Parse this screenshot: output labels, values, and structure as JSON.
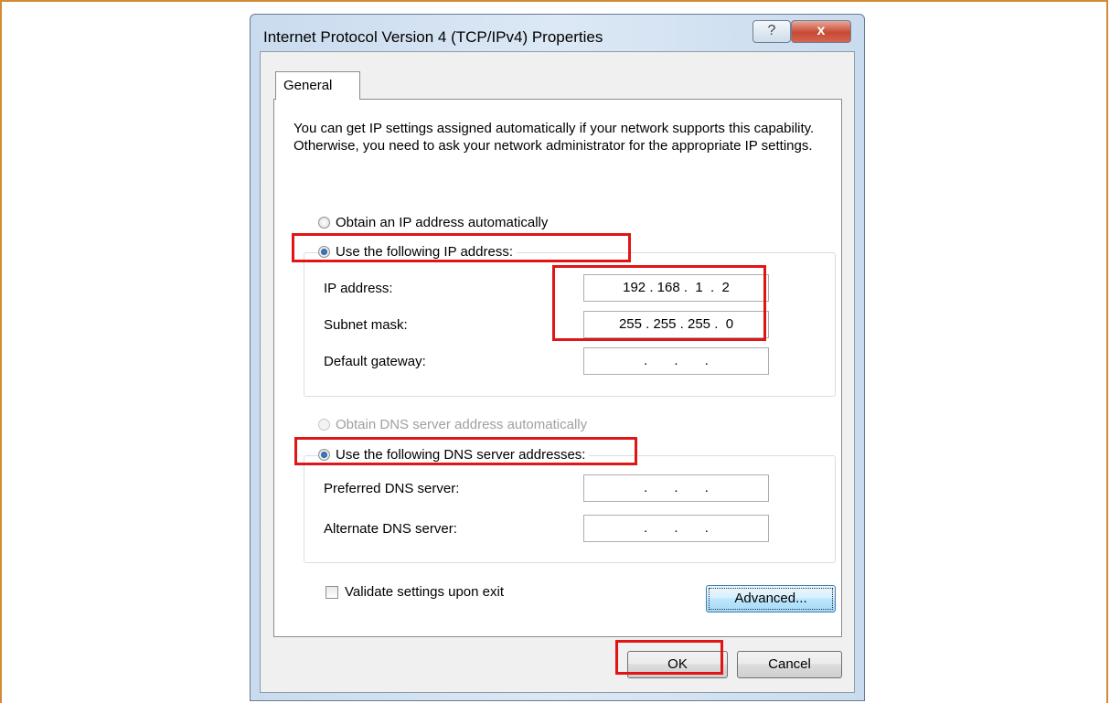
{
  "dialog": {
    "title": "Internet Protocol Version 4 (TCP/IPv4) Properties",
    "help_icon": "?",
    "close_icon": "x",
    "tab_label": "General",
    "description": "You can get IP settings assigned automatically if your network supports this capability. Otherwise, you need to ask your network administrator for the appropriate IP settings."
  },
  "ip_section": {
    "obtain_auto_label": "Obtain an IP address automatically",
    "use_following_label": "Use the following IP address:",
    "selected": "use_following",
    "ip_address_label": "IP address:",
    "ip_address_value": "192 . 168 .  1  .  2",
    "subnet_mask_label": "Subnet mask:",
    "subnet_mask_value": "255 . 255 . 255 .  0",
    "default_gateway_label": "Default gateway:",
    "default_gateway_value": ".       .       ."
  },
  "dns_section": {
    "obtain_auto_label": "Obtain DNS server address automatically",
    "use_following_label": "Use the following DNS server addresses:",
    "selected": "use_following",
    "preferred_label": "Preferred DNS server:",
    "preferred_value": ".       .       .",
    "alternate_label": "Alternate DNS server:",
    "alternate_value": ".       .       ."
  },
  "validate_label": "Validate settings upon exit",
  "validate_checked": false,
  "buttons": {
    "advanced": "Advanced...",
    "ok": "OK",
    "cancel": "Cancel"
  },
  "colors": {
    "highlight_box": "#e01515",
    "frame_border": "#d18b36"
  }
}
